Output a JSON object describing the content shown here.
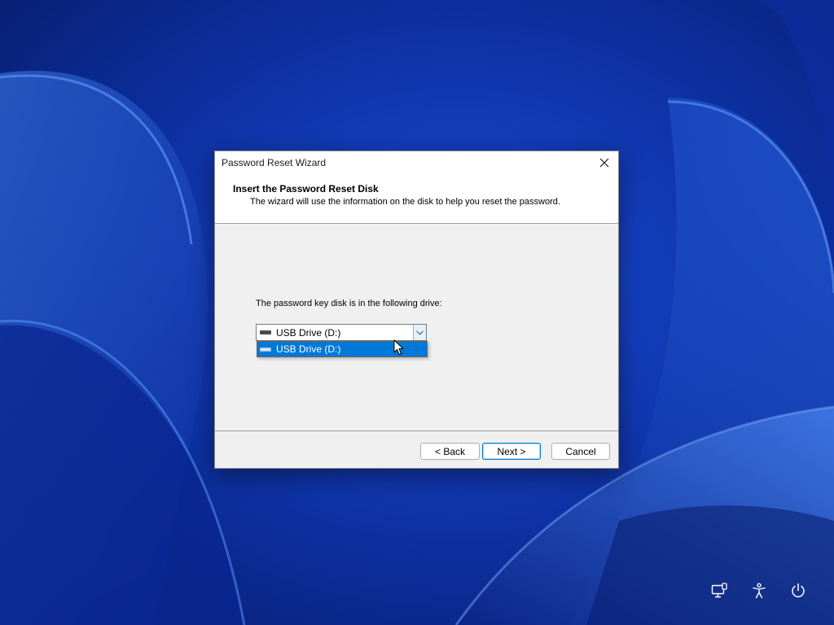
{
  "dialog": {
    "title": "Password Reset Wizard",
    "header_title": "Insert the Password Reset Disk",
    "header_subtitle": "The wizard will use the information on the disk to help you reset the password.",
    "drive_label": "The password key disk is in the following drive:",
    "drive_selected": "USB Drive (D:)",
    "drive_options": [
      "USB Drive (D:)"
    ],
    "buttons": {
      "back": "< Back",
      "next": "Next >",
      "cancel": "Cancel"
    }
  },
  "icons": {
    "close": "close-icon",
    "drive": "usb-drive-icon",
    "dropdown_arrow": "chevron-down-icon",
    "network": "network-icon",
    "accessibility": "accessibility-icon",
    "power": "power-icon"
  },
  "colors": {
    "wallpaper": "#0a2a8c",
    "selection": "#0078d7",
    "default_button_border": "#0078d7"
  }
}
